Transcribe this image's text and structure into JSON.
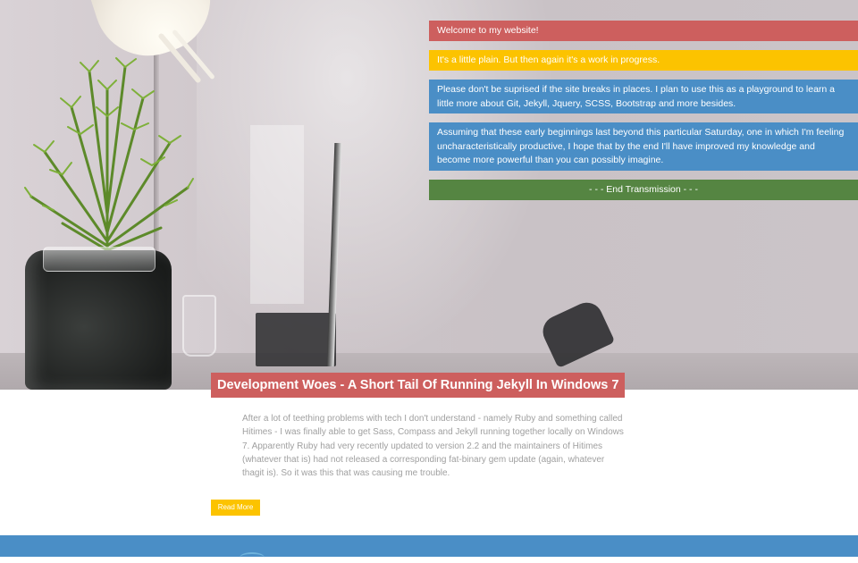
{
  "hero": {
    "messages": [
      "Welcome to my website!",
      "It's a little plain. But then again it's a work in progress.",
      "Please don't be suprised if the site breaks in places. I plan to use this as a playground to learn a little more about Git, Jekyll, Jquery, SCSS, Bootstrap and more besides.",
      "Assuming that these early beginnings last beyond this particular Saturday, one in which I'm feeling uncharacteristically productive, I hope that by the end I'll have improved my knowledge and become more powerful than you can possibly imagine.",
      "- - - End Transmission - - -"
    ]
  },
  "post": {
    "title": "Development Woes - A Short Tail Of Running Jekyll In Windows 7",
    "excerpt": "After a lot of teething problems with tech I don't understand - namely Ruby and something called Hitimes - I was finally able to get Sass, Compass and Jekyll running together locally on Windows 7. Apparently Ruby had very recently updated to version 2.2 and the maintainers of Hitimes (whatever that is) had not released a corresponding fat-binary gem update (again, whatever thagit is). So it was this that was causing me trouble.",
    "read_more_label": "Read More"
  },
  "colors": {
    "red": "#cd5f5e",
    "yellow": "#fcc300",
    "blue": "#4a8ec6",
    "green": "#558542"
  }
}
